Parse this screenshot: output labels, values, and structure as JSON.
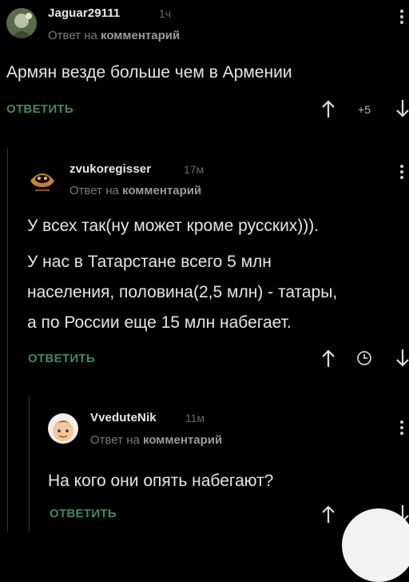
{
  "comments": [
    {
      "username": "Jaguar29111",
      "time": "1ч",
      "reply_prefix": "Ответ на",
      "reply_target": "комментарий",
      "body_lines": [
        "Армян везде больше чем в Армении"
      ],
      "reply_label": "ОТВЕТИТЬ",
      "rating": "+5"
    },
    {
      "username": "zvukoregisser",
      "time": "17м",
      "reply_prefix": "Ответ на",
      "reply_target": "комментарий",
      "body_lines": [
        "У всех так(ну может кроме русских))).",
        "У нас в Татарстане всего 5 млн",
        "населения, половина(2,5 млн) - татары,",
        "а по России еще 15 млн набегает."
      ],
      "reply_label": "ОТВЕТИТЬ"
    },
    {
      "username": "VvedutеNik",
      "time": "11м",
      "reply_prefix": "Ответ на",
      "reply_target": "комментарий",
      "body_lines": [
        "На кого они опять набегают?"
      ],
      "reply_label": "ОТВЕТИТЬ"
    }
  ],
  "icons": {
    "upvote": "arrow-up-icon",
    "downvote": "arrow-down-icon",
    "rating_hidden": "clock-icon",
    "more": "kebab-menu-icon"
  },
  "colors": {
    "background": "#000000",
    "reply_accent": "#3f8a57",
    "thread_line": "#3a3a3a"
  }
}
